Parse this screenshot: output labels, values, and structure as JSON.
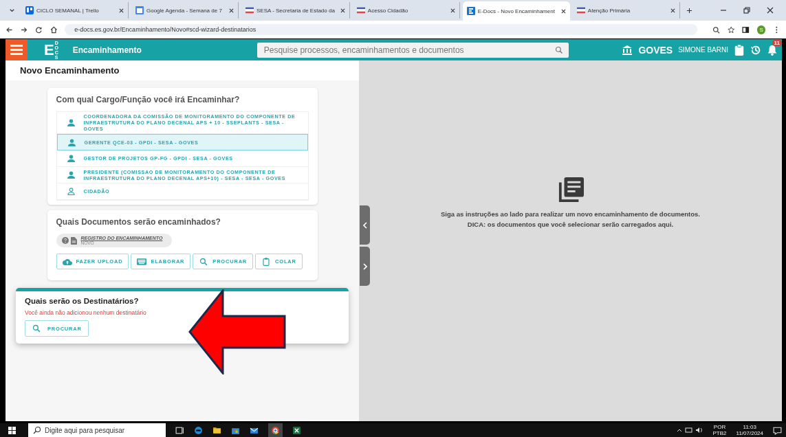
{
  "browser": {
    "tabs": [
      {
        "title": "CICLO SEMANAL | Trello",
        "kind": "board",
        "selected": false
      },
      {
        "title": "Google Agenda - Semana de 7",
        "kind": "calendar",
        "selected": false
      },
      {
        "title": "SESA - Secretaria de Estado da",
        "kind": "flag",
        "selected": false
      },
      {
        "title": "Acesso Cidadão",
        "kind": "flag",
        "selected": false
      },
      {
        "title": "E-Docs - Novo Encaminhament",
        "kind": "docs",
        "selected": true
      },
      {
        "title": "Atenção Primária",
        "kind": "flag",
        "selected": false
      }
    ],
    "url": "e-docs.es.gov.br/Encaminhamento/Novo#scd-wizard-destinatarios",
    "profile_initial": "S"
  },
  "header": {
    "logo": "E",
    "logo_sub": "DOCS",
    "title": "Encaminhamento",
    "search": {
      "placeholder": "Pesquise processos, encaminhamentos e documentos"
    },
    "org": "GOVES",
    "user": "SIMONE BARNI",
    "notifications": "11"
  },
  "page_title": "Novo Encaminhamento",
  "roles": {
    "question": "Com qual Cargo/Função você irá Encaminhar?",
    "items": [
      {
        "label": "COORDENADORA DA COMISSÃO DE MONITORAMENTO DO COMPONENTE DE INFRAESTRUTURA DO PLANO DECENAL APS + 10 - SSEPLANTS - SESA - GOVES",
        "kind": "filled",
        "selected": false
      },
      {
        "label": "GERENTE QCE-03 - GPDI - SESA - GOVES",
        "kind": "filled",
        "selected": true
      },
      {
        "label": "GESTOR DE PROJETOS GP-FG - GPDI - SESA - GOVES",
        "kind": "filled",
        "selected": false
      },
      {
        "label": "PRESIDENTE (COMISSAO DE MONITORAMENTO DO COMPONENTE DE INFRAESTRUTURA DO PLANO DECENAL APS+10) - SESA - SESA - GOVES",
        "kind": "filled",
        "selected": false
      },
      {
        "label": "CIDADÃO",
        "kind": "outline",
        "selected": false
      }
    ]
  },
  "documents": {
    "question": "Quais Documentos serão encaminhados?",
    "doc": {
      "name": "REGISTRO DO ENCAMINHAMENTO",
      "status": "NOVO"
    },
    "actions": [
      {
        "label": "FAZER UPLOAD",
        "kind": "upload"
      },
      {
        "label": "ELABORAR",
        "kind": "compose"
      },
      {
        "label": "PROCURAR",
        "kind": "search"
      },
      {
        "label": "COLAR",
        "kind": "paste"
      }
    ]
  },
  "recipients": {
    "question": "Quais serão os Destinatários?",
    "warning": "Você ainda não adicionou nenhum destinatário",
    "action": "PROCURAR"
  },
  "preview": {
    "lines": [
      "Siga as instruções ao lado para realizar um novo encaminhamento de documentos.",
      "DICA: os documentos que você selecionar serão carregados aqui."
    ]
  },
  "taskbar": {
    "search": {
      "placeholder": "Digite aqui para pesquisar"
    },
    "language": "POR",
    "layout": "PTB2",
    "time": "11:03",
    "date": "11/07/2024"
  }
}
